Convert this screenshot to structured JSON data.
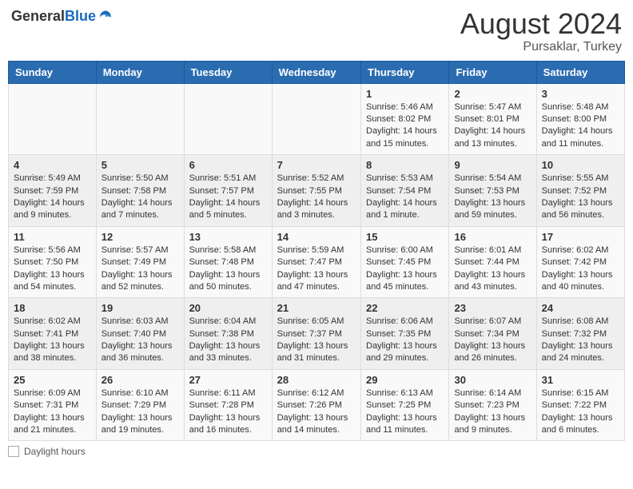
{
  "logo": {
    "general": "General",
    "blue": "Blue"
  },
  "title": "August 2024",
  "subtitle": "Pursaklar, Turkey",
  "days_header": [
    "Sunday",
    "Monday",
    "Tuesday",
    "Wednesday",
    "Thursday",
    "Friday",
    "Saturday"
  ],
  "weeks": [
    [
      {
        "day": "",
        "info": ""
      },
      {
        "day": "",
        "info": ""
      },
      {
        "day": "",
        "info": ""
      },
      {
        "day": "",
        "info": ""
      },
      {
        "day": "1",
        "info": "Sunrise: 5:46 AM\nSunset: 8:02 PM\nDaylight: 14 hours and 15 minutes."
      },
      {
        "day": "2",
        "info": "Sunrise: 5:47 AM\nSunset: 8:01 PM\nDaylight: 14 hours and 13 minutes."
      },
      {
        "day": "3",
        "info": "Sunrise: 5:48 AM\nSunset: 8:00 PM\nDaylight: 14 hours and 11 minutes."
      }
    ],
    [
      {
        "day": "4",
        "info": "Sunrise: 5:49 AM\nSunset: 7:59 PM\nDaylight: 14 hours and 9 minutes."
      },
      {
        "day": "5",
        "info": "Sunrise: 5:50 AM\nSunset: 7:58 PM\nDaylight: 14 hours and 7 minutes."
      },
      {
        "day": "6",
        "info": "Sunrise: 5:51 AM\nSunset: 7:57 PM\nDaylight: 14 hours and 5 minutes."
      },
      {
        "day": "7",
        "info": "Sunrise: 5:52 AM\nSunset: 7:55 PM\nDaylight: 14 hours and 3 minutes."
      },
      {
        "day": "8",
        "info": "Sunrise: 5:53 AM\nSunset: 7:54 PM\nDaylight: 14 hours and 1 minute."
      },
      {
        "day": "9",
        "info": "Sunrise: 5:54 AM\nSunset: 7:53 PM\nDaylight: 13 hours and 59 minutes."
      },
      {
        "day": "10",
        "info": "Sunrise: 5:55 AM\nSunset: 7:52 PM\nDaylight: 13 hours and 56 minutes."
      }
    ],
    [
      {
        "day": "11",
        "info": "Sunrise: 5:56 AM\nSunset: 7:50 PM\nDaylight: 13 hours and 54 minutes."
      },
      {
        "day": "12",
        "info": "Sunrise: 5:57 AM\nSunset: 7:49 PM\nDaylight: 13 hours and 52 minutes."
      },
      {
        "day": "13",
        "info": "Sunrise: 5:58 AM\nSunset: 7:48 PM\nDaylight: 13 hours and 50 minutes."
      },
      {
        "day": "14",
        "info": "Sunrise: 5:59 AM\nSunset: 7:47 PM\nDaylight: 13 hours and 47 minutes."
      },
      {
        "day": "15",
        "info": "Sunrise: 6:00 AM\nSunset: 7:45 PM\nDaylight: 13 hours and 45 minutes."
      },
      {
        "day": "16",
        "info": "Sunrise: 6:01 AM\nSunset: 7:44 PM\nDaylight: 13 hours and 43 minutes."
      },
      {
        "day": "17",
        "info": "Sunrise: 6:02 AM\nSunset: 7:42 PM\nDaylight: 13 hours and 40 minutes."
      }
    ],
    [
      {
        "day": "18",
        "info": "Sunrise: 6:02 AM\nSunset: 7:41 PM\nDaylight: 13 hours and 38 minutes."
      },
      {
        "day": "19",
        "info": "Sunrise: 6:03 AM\nSunset: 7:40 PM\nDaylight: 13 hours and 36 minutes."
      },
      {
        "day": "20",
        "info": "Sunrise: 6:04 AM\nSunset: 7:38 PM\nDaylight: 13 hours and 33 minutes."
      },
      {
        "day": "21",
        "info": "Sunrise: 6:05 AM\nSunset: 7:37 PM\nDaylight: 13 hours and 31 minutes."
      },
      {
        "day": "22",
        "info": "Sunrise: 6:06 AM\nSunset: 7:35 PM\nDaylight: 13 hours and 29 minutes."
      },
      {
        "day": "23",
        "info": "Sunrise: 6:07 AM\nSunset: 7:34 PM\nDaylight: 13 hours and 26 minutes."
      },
      {
        "day": "24",
        "info": "Sunrise: 6:08 AM\nSunset: 7:32 PM\nDaylight: 13 hours and 24 minutes."
      }
    ],
    [
      {
        "day": "25",
        "info": "Sunrise: 6:09 AM\nSunset: 7:31 PM\nDaylight: 13 hours and 21 minutes."
      },
      {
        "day": "26",
        "info": "Sunrise: 6:10 AM\nSunset: 7:29 PM\nDaylight: 13 hours and 19 minutes."
      },
      {
        "day": "27",
        "info": "Sunrise: 6:11 AM\nSunset: 7:28 PM\nDaylight: 13 hours and 16 minutes."
      },
      {
        "day": "28",
        "info": "Sunrise: 6:12 AM\nSunset: 7:26 PM\nDaylight: 13 hours and 14 minutes."
      },
      {
        "day": "29",
        "info": "Sunrise: 6:13 AM\nSunset: 7:25 PM\nDaylight: 13 hours and 11 minutes."
      },
      {
        "day": "30",
        "info": "Sunrise: 6:14 AM\nSunset: 7:23 PM\nDaylight: 13 hours and 9 minutes."
      },
      {
        "day": "31",
        "info": "Sunrise: 6:15 AM\nSunset: 7:22 PM\nDaylight: 13 hours and 6 minutes."
      }
    ]
  ],
  "footer": {
    "daylight_label": "Daylight hours"
  }
}
